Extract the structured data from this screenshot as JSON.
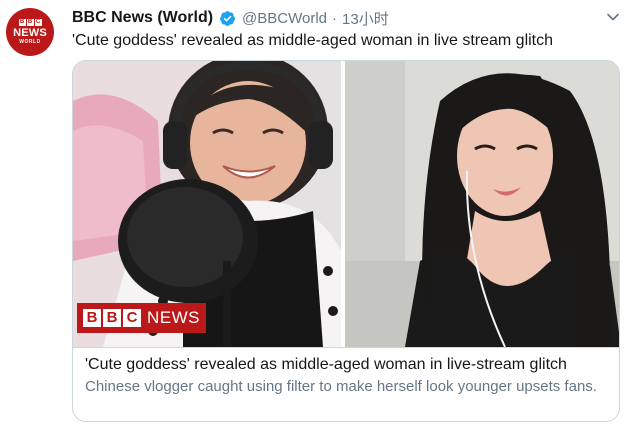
{
  "tweet": {
    "author_name": "BBC News (World)",
    "handle": "@BBCWorld",
    "separator": "·",
    "time": "13小时",
    "text": "'Cute goddess' revealed as middle-aged woman in live stream glitch",
    "verified": true
  },
  "avatar": {
    "letters": [
      "B",
      "B",
      "C"
    ],
    "line1": "NEWS",
    "line2": "WORLD"
  },
  "card": {
    "logo_letters": [
      "B",
      "B",
      "C"
    ],
    "logo_text": "NEWS",
    "title": "'Cute goddess' revealed as middle-aged woman in live-stream glitch",
    "description": "Chinese vlogger caught using filter to make herself look younger upsets fans."
  },
  "icons": {
    "verified": "verified-badge-icon",
    "menu": "chevron-down-icon"
  },
  "colors": {
    "brand_red": "#bb1919",
    "verified_blue": "#1da1f2",
    "text_primary": "#14171a",
    "text_secondary": "#657786",
    "border": "#ccd6dd"
  }
}
